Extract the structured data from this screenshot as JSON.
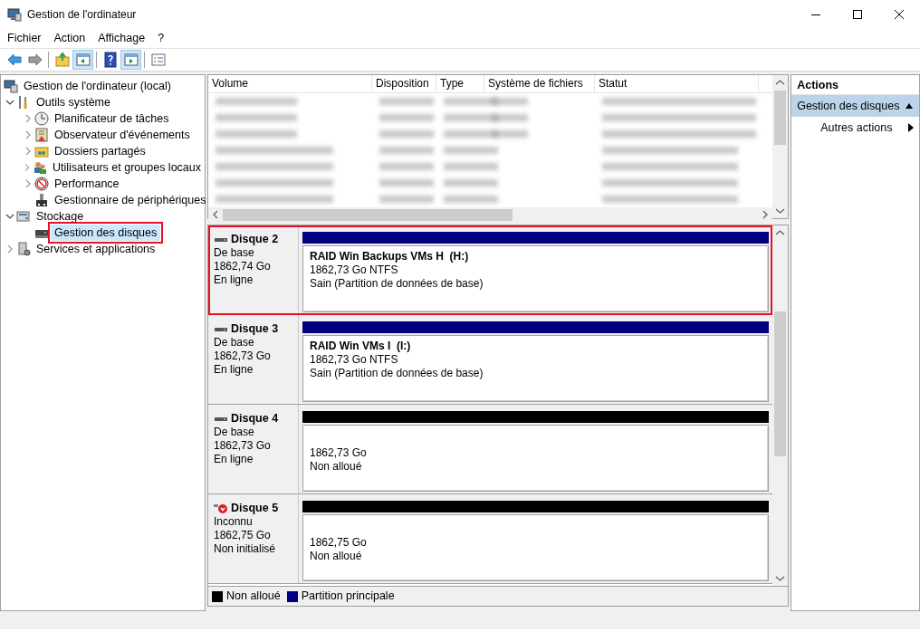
{
  "window": {
    "title": "Gestion de l'ordinateur"
  },
  "menu": [
    "Fichier",
    "Action",
    "Affichage",
    "?"
  ],
  "toolbar": [
    {
      "kind": "back",
      "pressed": false
    },
    {
      "kind": "forward",
      "pressed": false
    },
    {
      "kind": "sep"
    },
    {
      "kind": "up",
      "pressed": false
    },
    {
      "kind": "tree",
      "pressed": true
    },
    {
      "kind": "sep"
    },
    {
      "kind": "help",
      "pressed": false
    },
    {
      "kind": "actionpane",
      "pressed": true
    },
    {
      "kind": "sep"
    },
    {
      "kind": "properties",
      "pressed": false
    }
  ],
  "tree": [
    {
      "label": "Gestion de l'ordinateur (local)",
      "kind": "computer",
      "selected": false,
      "highlighted": false,
      "children": [
        {
          "label": "Outils système",
          "kind": "tools",
          "expanded": true,
          "selected": false,
          "highlighted": false,
          "children": [
            {
              "label": "Planificateur de tâches",
              "kind": "clock",
              "expanded": false,
              "selected": false,
              "highlighted": false
            },
            {
              "label": "Observateur d'événements",
              "kind": "log",
              "expanded": false,
              "selected": false,
              "highlighted": false
            },
            {
              "label": "Dossiers partagés",
              "kind": "share",
              "expanded": false,
              "selected": false,
              "highlighted": false
            },
            {
              "label": "Utilisateurs et groupes locaux",
              "kind": "users",
              "expanded": false,
              "selected": false,
              "highlighted": false
            },
            {
              "label": "Performance",
              "kind": "performance",
              "expanded": false,
              "selected": false,
              "highlighted": false
            },
            {
              "label": "Gestionnaire de périphériques",
              "kind": "devices",
              "selected": false,
              "highlighted": false
            }
          ]
        },
        {
          "label": "Stockage",
          "kind": "storage",
          "expanded": true,
          "selected": false,
          "highlighted": false,
          "children": [
            {
              "label": "Gestion des disques",
              "kind": "disk",
              "selected": true,
              "highlighted": true
            }
          ]
        },
        {
          "label": "Services et applications",
          "kind": "services",
          "expanded": false,
          "selected": false,
          "highlighted": false
        }
      ]
    }
  ],
  "volume_list": {
    "columns": [
      "Volume",
      "Disposition",
      "Type",
      "Système de fichiers",
      "Statut"
    ],
    "rows": [
      {
        "cells_blurred": [
          true,
          true,
          true,
          true,
          true
        ]
      },
      {
        "cells_blurred": [
          true,
          true,
          true,
          true,
          true
        ]
      },
      {
        "cells_blurred": [
          true,
          true,
          true,
          true,
          true
        ]
      },
      {
        "cells_blurred": [
          true,
          true,
          true,
          false,
          true
        ]
      },
      {
        "cells_blurred": [
          true,
          true,
          true,
          false,
          true
        ]
      },
      {
        "cells_blurred": [
          true,
          true,
          true,
          false,
          true
        ]
      },
      {
        "cells_blurred": [
          true,
          true,
          true,
          false,
          true
        ]
      }
    ]
  },
  "disks": [
    {
      "name": "Disque 2",
      "kind": "online",
      "type": "De base",
      "size": "1862,74 Go",
      "state": "En ligne",
      "highlighted": true,
      "partition": {
        "kind": "primary",
        "title": "RAID Win Backups VMs H  (H:)",
        "lines": [
          "1862,73 Go NTFS",
          "Sain (Partition de données de base)"
        ]
      }
    },
    {
      "name": "Disque 3",
      "kind": "online",
      "type": "De base",
      "size": "1862,73 Go",
      "state": "En ligne",
      "highlighted": false,
      "partition": {
        "kind": "primary",
        "title": "RAID Win VMs I  (I:)",
        "lines": [
          "1862,73 Go NTFS",
          "Sain (Partition de données de base)"
        ]
      }
    },
    {
      "name": "Disque 4",
      "kind": "online",
      "type": "De base",
      "size": "1862,73 Go",
      "state": "En ligne",
      "highlighted": false,
      "partition": {
        "kind": "unallocated",
        "lines": [
          "1862,73 Go",
          "Non alloué"
        ]
      }
    },
    {
      "name": "Disque 5",
      "kind": "error",
      "type": "Inconnu",
      "size": "1862,75 Go",
      "state": "Non initialisé",
      "highlighted": false,
      "partition": {
        "kind": "unallocated",
        "lines": [
          "1862,75 Go",
          "Non alloué"
        ]
      }
    }
  ],
  "legend": [
    {
      "label": "Non alloué",
      "color": "#000000"
    },
    {
      "label": "Partition principale",
      "color": "#000080"
    }
  ],
  "actions": {
    "title": "Actions",
    "section": {
      "label": "Gestion des disques",
      "expanded": true
    },
    "items": [
      {
        "label": "Autres actions"
      }
    ]
  }
}
